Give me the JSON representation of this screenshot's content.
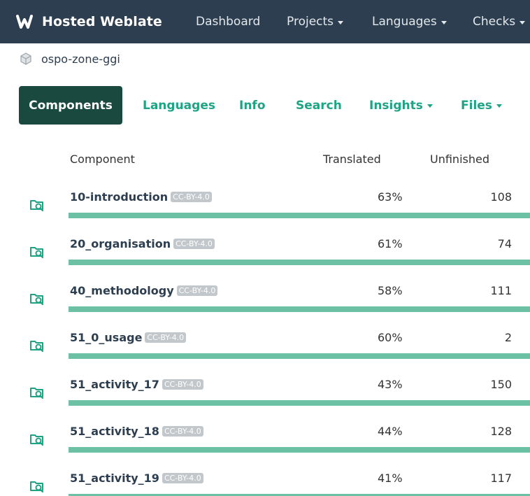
{
  "navbar": {
    "brand": "Hosted Weblate",
    "items": [
      {
        "label": "Dashboard",
        "dropdown": false
      },
      {
        "label": "Projects",
        "dropdown": true
      },
      {
        "label": "Languages",
        "dropdown": true
      },
      {
        "label": "Checks",
        "dropdown": true
      }
    ]
  },
  "breadcrumb": {
    "project": "ospo-zone-ggi",
    "icon": "package-icon"
  },
  "tabs": [
    {
      "label": "Components",
      "active": true
    },
    {
      "label": "Languages"
    },
    {
      "label": "Info"
    },
    {
      "label": "Search"
    },
    {
      "label": "Insights",
      "dropdown": true
    },
    {
      "label": "Files",
      "dropdown": true
    }
  ],
  "table": {
    "columns": [
      "Component",
      "Translated",
      "Unfinished"
    ],
    "rows": [
      {
        "name": "10-introduction",
        "license": "CC-BY-4.0",
        "translated": "63%",
        "translated_fraction": 0.63,
        "unfinished": "108"
      },
      {
        "name": "20_organisation",
        "license": "CC-BY-4.0",
        "translated": "61%",
        "translated_fraction": 0.61,
        "unfinished": "74"
      },
      {
        "name": "40_methodology",
        "license": "CC-BY-4.0",
        "translated": "58%",
        "translated_fraction": 0.58,
        "unfinished": "111"
      },
      {
        "name": "51_0_usage",
        "license": "CC-BY-4.0",
        "translated": "60%",
        "translated_fraction": 0.6,
        "unfinished": "2"
      },
      {
        "name": "51_activity_17",
        "license": "CC-BY-4.0",
        "translated": "43%",
        "translated_fraction": 0.43,
        "unfinished": "150"
      },
      {
        "name": "51_activity_18",
        "license": "CC-BY-4.0",
        "translated": "44%",
        "translated_fraction": 0.44,
        "unfinished": "128"
      },
      {
        "name": "51_activity_19",
        "license": "CC-BY-4.0",
        "translated": "41%",
        "translated_fraction": 0.41,
        "unfinished": "117"
      }
    ]
  },
  "colors": {
    "navbar_bg": "#2c3e50",
    "accent": "#1fa385",
    "active_tab_bg": "#1a4a3f",
    "progress_bar": "#6cc0a4",
    "license_badge": "#c2c7cb"
  }
}
